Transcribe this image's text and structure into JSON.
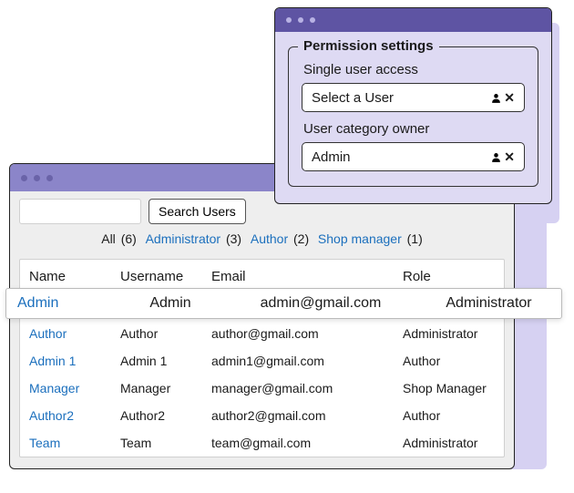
{
  "toolbar": {
    "search_value": "",
    "search_button": "Search Users"
  },
  "filters": {
    "all_label": "All",
    "all_count": "(6)",
    "admin_label": "Administrator",
    "admin_count": "(3)",
    "author_label": "Author",
    "author_count": "(2)",
    "shop_label": "Shop manager",
    "shop_count": "(1)"
  },
  "table": {
    "headers": {
      "name": "Name",
      "username": "Username",
      "email": "Email",
      "role": "Role"
    },
    "selected": {
      "name": "Admin",
      "username": "Admin",
      "email": "admin@gmail.com",
      "role": "Administrator"
    },
    "rows": [
      {
        "name": "Author",
        "username": "Author",
        "email": "author@gmail.com",
        "role": "Administrator"
      },
      {
        "name": "Admin 1",
        "username": "Admin 1",
        "email": "admin1@gmail.com",
        "role": "Author"
      },
      {
        "name": "Manager",
        "username": "Manager",
        "email": "manager@gmail.com",
        "role": "Shop Manager"
      },
      {
        "name": "Author2",
        "username": "Author2",
        "email": "author2@gmail.com",
        "role": "Author"
      },
      {
        "name": "Team",
        "username": "Team",
        "email": "team@gmail.com",
        "role": "Administrator"
      }
    ]
  },
  "modal": {
    "legend": "Permission settings",
    "single_label": "Single user access",
    "single_value": "Select a User",
    "owner_label": "User category owner",
    "owner_value": "Admin"
  }
}
